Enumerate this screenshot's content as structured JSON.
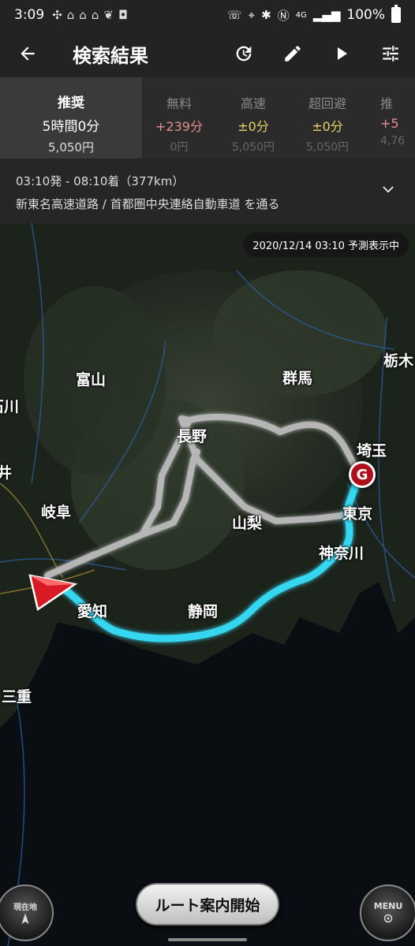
{
  "status_bar": {
    "time": "3:09",
    "battery": "100%",
    "network": "4G"
  },
  "app_bar": {
    "title": "検索結果",
    "icons": [
      "back-arrow-icon",
      "history-icon",
      "edit-icon",
      "play-icon",
      "settings-sliders-icon"
    ]
  },
  "route_tabs": [
    {
      "name": "推奨",
      "diff": "5時間0分",
      "cost": "5,050円",
      "active": true
    },
    {
      "name": "無料",
      "diff": "+239分",
      "cost": "0円",
      "active": false
    },
    {
      "name": "高速",
      "diff": "±0分",
      "cost": "5,050円",
      "active": false
    },
    {
      "name": "超回避",
      "diff": "±0分",
      "cost": "5,050円",
      "active": false
    },
    {
      "name": "推",
      "diff": "+5",
      "cost": "4,76",
      "active": false
    }
  ],
  "route_info": {
    "time_line": "03:10発 - 08:10着（377km）",
    "via_line": "新東名高速道路 / 首都圏中央連絡自動車道 を通る"
  },
  "map": {
    "timestamp": "2020/12/14 03:10",
    "timestamp_label": "予測表示中",
    "goal_label": "G",
    "prefectures": {
      "toyama": "富山",
      "gunma": "群馬",
      "tochigi": "栃木",
      "ishikawa": "石川",
      "nagano": "長野",
      "saitama": "埼玉",
      "fukui": "井",
      "gifu": "岐阜",
      "yamanashi": "山梨",
      "tokyo": "東京",
      "kanagawa": "神奈川",
      "aichi": "愛知",
      "shizuoka": "静岡",
      "mie": "三重"
    },
    "route_color": "#35d6f0",
    "alt_route_color": "#bdbdbd"
  },
  "controls": {
    "start_guidance": "ルート案内開始",
    "current_location": "現在地",
    "menu": "MENU"
  }
}
